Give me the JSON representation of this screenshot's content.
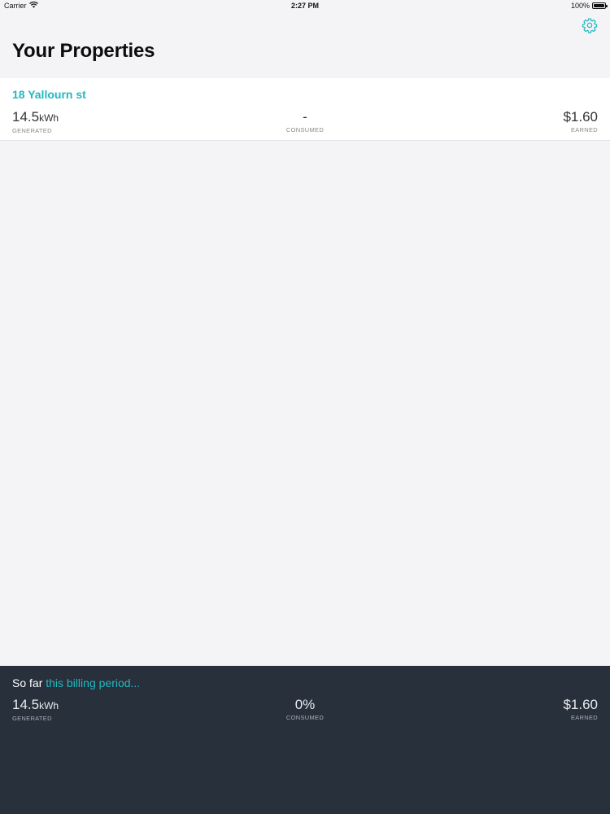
{
  "status_bar": {
    "carrier": "Carrier",
    "time": "2:27 PM",
    "battery": "100%",
    "battery_level": 1.0
  },
  "header": {
    "title": "Your Properties",
    "settings_icon": "gear-icon"
  },
  "properties": [
    {
      "name": "18 Yallourn st",
      "generated_value": "14.5",
      "generated_unit": "kWh",
      "generated_label": "GENERATED",
      "consumed_value": "-",
      "consumed_label": "CONSUMED",
      "earned_value": "$1.60",
      "earned_label": "EARNED"
    }
  ],
  "summary": {
    "prefix": "So far",
    "highlight": "this billing period...",
    "generated_value": "14.5",
    "generated_unit": "kWh",
    "generated_label": "GENERATED",
    "consumed_value": "0%",
    "consumed_label": "CONSUMED",
    "earned_value": "$1.60",
    "earned_label": "EARNED"
  },
  "colors": {
    "accent": "#22b8c2",
    "background": "#f4f3f6",
    "summary_background": "#27303b"
  }
}
